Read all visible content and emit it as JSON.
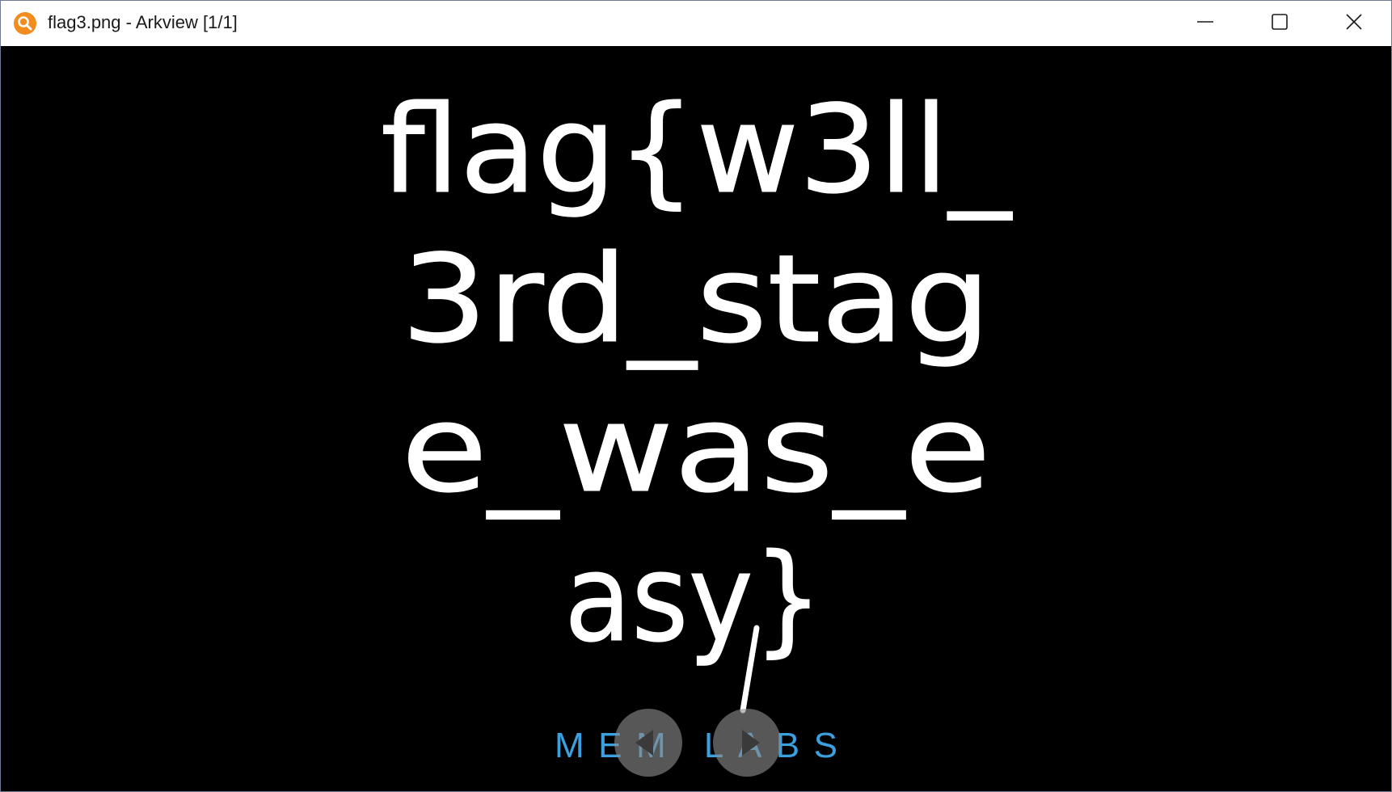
{
  "window": {
    "title": "flag3.png - Arkview [1/1]",
    "app_icon": "magnifier-icon",
    "controls": {
      "minimize": "minimize-icon",
      "maximize": "maximize-icon",
      "close": "close-icon"
    }
  },
  "image": {
    "file_name": "flag3.png",
    "handwritten_lines": [
      "flag{w3ll_",
      "3rd_stag",
      "e_was_e",
      "asy}"
    ],
    "watermark": "MEM LABS",
    "colors": {
      "background": "#000000",
      "ink": "#ffffff",
      "watermark": "#3aa0e0"
    }
  },
  "navigation": {
    "previous": "chevron-left-icon",
    "next": "chevron-right-icon"
  }
}
